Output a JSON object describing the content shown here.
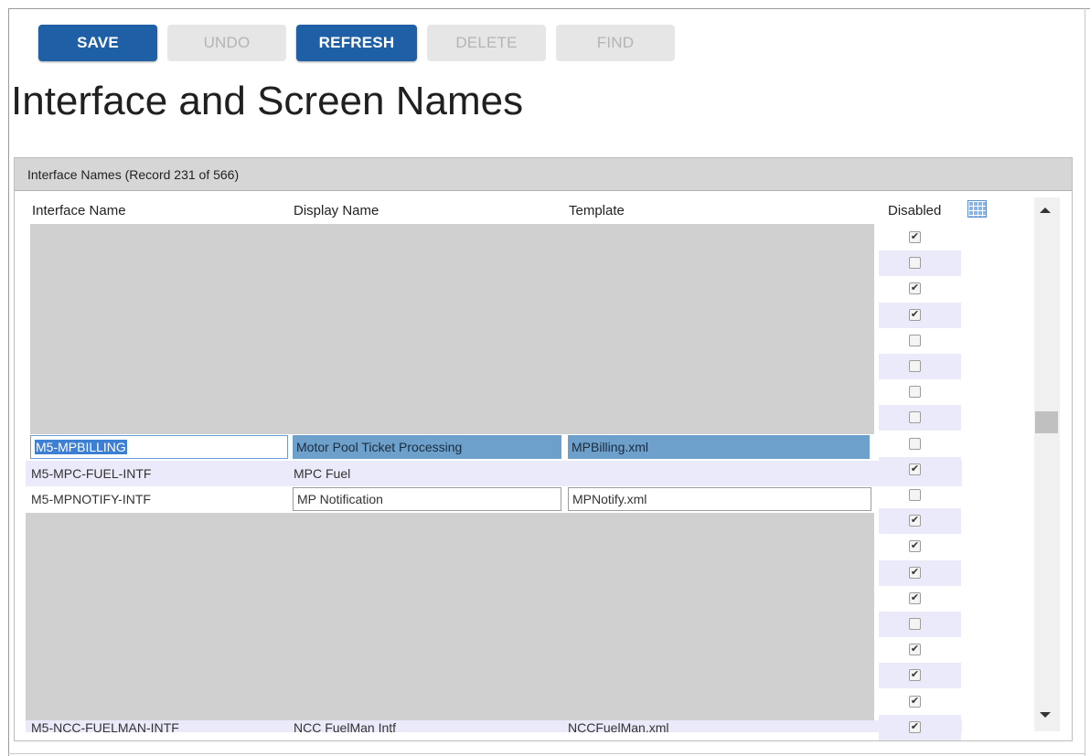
{
  "toolbar": {
    "save": "SAVE",
    "undo": "UNDO",
    "refresh": "REFRESH",
    "delete": "DELETE",
    "find": "FIND"
  },
  "page_title": "Interface and Screen Names",
  "panel": {
    "title": "Interface Names (Record 231 of 566)"
  },
  "columns": {
    "interface_name": "Interface Name",
    "display_name": "Display Name",
    "template": "Template",
    "disabled": "Disabled"
  },
  "rows": [
    {
      "interface": "M5-MPBILLING",
      "display": "Motor Pool Ticket Processing",
      "template": "MPBilling.xml"
    },
    {
      "interface": "M5-MPC-FUEL-INTF",
      "display": "MPC Fuel",
      "template": ""
    },
    {
      "interface": "M5-MPNOTIFY-INTF",
      "display": "MP Notification",
      "template": "MPNotify.xml"
    },
    {
      "interface": "M5-NCC-FUELMAN-INTF",
      "display": "NCC FuelMan Intf",
      "template": "NCCFuelMan.xml"
    }
  ],
  "disabled_flags": [
    true,
    false,
    true,
    true,
    false,
    false,
    false,
    false,
    false,
    true,
    false,
    true,
    true,
    true,
    true,
    false,
    true,
    true,
    true,
    true
  ],
  "icons": {
    "column_chooser": "grid-icon",
    "scroll_up": "triangle-up-icon",
    "scroll_down": "triangle-down-icon",
    "check": "check-icon"
  },
  "colors": {
    "primary_button": "#1f5fa6",
    "selected_row": "#6ea0cc",
    "alt_row": "#eaeafb"
  }
}
